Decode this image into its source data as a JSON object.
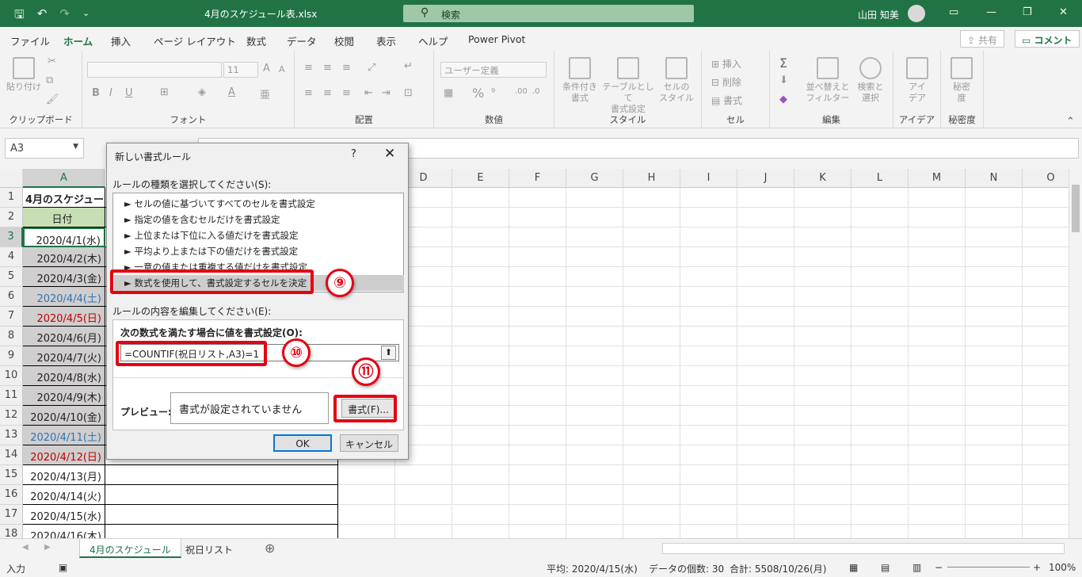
{
  "titlebar": {
    "filename": "4月のスケジュール表.xlsx",
    "search_placeholder": "検索",
    "user_name": "山田 知美",
    "accent_color": "#217346"
  },
  "menu_tabs": [
    "ファイル",
    "ホーム",
    "挿入",
    "ページ レイアウト",
    "数式",
    "データ",
    "校閲",
    "表示",
    "ヘルプ",
    "Power Pivot"
  ],
  "active_tab": "ホーム",
  "share_label": "共有",
  "comment_label": "コメント",
  "ribbon": {
    "clipboard": {
      "paste_label": "貼り付け",
      "group_label": "クリップボード"
    },
    "font": {
      "font_size": "11",
      "group_label": "フォント"
    },
    "alignment": {
      "group_label": "配置"
    },
    "number": {
      "format_value": "ユーザー定義",
      "group_label": "数値"
    },
    "styles": {
      "cond_label": "条件付き\n書式",
      "table_label": "テーブルとして\n書式設定",
      "cell_style_label": "セルの\nスタイル",
      "group_label": "スタイル"
    },
    "cells": {
      "insert": "挿入",
      "delete": "削除",
      "format": "書式",
      "group_label": "セル"
    },
    "editing": {
      "sort_label": "並べ替えと\nフィルター",
      "find_label": "検索と\n選択",
      "group_label": "編集"
    },
    "ideas": {
      "label": "アイ\nデア",
      "group_label": "アイデア"
    },
    "sensitivity": {
      "label": "秘密\n度",
      "group_label": "秘密度"
    }
  },
  "name_box": "A3",
  "columns": [
    "A",
    "D",
    "E",
    "F",
    "G",
    "H",
    "I",
    "J",
    "K",
    "L",
    "M",
    "N",
    "O"
  ],
  "rows": [
    "1",
    "2",
    "3",
    "4",
    "5",
    "6",
    "7",
    "8",
    "9",
    "10",
    "11",
    "12",
    "13",
    "14",
    "15",
    "16",
    "17",
    "18"
  ],
  "cells": {
    "a1": "4月のスケジュー",
    "a2": "日付",
    "dates": [
      {
        "text": "2020/4/1(水)",
        "style": "white"
      },
      {
        "text": "2020/4/2(木)",
        "style": "normal"
      },
      {
        "text": "2020/4/3(金)",
        "style": "normal"
      },
      {
        "text": "2020/4/4(土)",
        "style": "blue"
      },
      {
        "text": "2020/4/5(日)",
        "style": "red"
      },
      {
        "text": "2020/4/6(月)",
        "style": "normal"
      },
      {
        "text": "2020/4/7(火)",
        "style": "normal"
      },
      {
        "text": "2020/4/8(水)",
        "style": "normal"
      },
      {
        "text": "2020/4/9(木)",
        "style": "normal"
      },
      {
        "text": "2020/4/10(金)",
        "style": "normal"
      },
      {
        "text": "2020/4/11(土)",
        "style": "blue"
      },
      {
        "text": "2020/4/12(日)",
        "style": "red"
      },
      {
        "text": "2020/4/13(月)",
        "style": "normal"
      },
      {
        "text": "2020/4/14(火)",
        "style": "normal"
      },
      {
        "text": "2020/4/15(水)",
        "style": "normal"
      },
      {
        "text": "2020/4/16(木)",
        "style": "normal"
      }
    ]
  },
  "sheet_tabs": [
    "4月のスケジュール",
    "祝日リスト"
  ],
  "status": {
    "mode": "入力",
    "average": "平均: 2020/4/15(水)",
    "count": "データの個数: 30",
    "sum": "合計: 5508/10/26(月)",
    "zoom": "100%"
  },
  "dialog": {
    "title": "新しい書式ルール",
    "help": "?",
    "close": "✕",
    "type_label": "ルールの種類を選択してください(S):",
    "rule_types": [
      "► セルの値に基づいてすべてのセルを書式設定",
      "► 指定の値を含むセルだけを書式設定",
      "► 上位または下位に入る値だけを書式設定",
      "► 平均より上または下の値だけを書式設定",
      "► 一意の値または重複する値だけを書式設定",
      "► 数式を使用して、書式設定するセルを決定"
    ],
    "edit_label": "ルールの内容を編集してください(E):",
    "formula_heading": "次の数式を満たす場合に値を書式設定(O):",
    "formula_value": "=COUNTIF(祝日リスト,A3)=1",
    "preview_label": "プレビュー:",
    "preview_text": "書式が設定されていません",
    "format_button": "書式(F)...",
    "ok_button": "OK",
    "cancel_button": "キャンセル"
  },
  "annotations": {
    "step9": "⑨",
    "step10": "⑩",
    "step11": "⑪",
    "color": "#e60012"
  }
}
